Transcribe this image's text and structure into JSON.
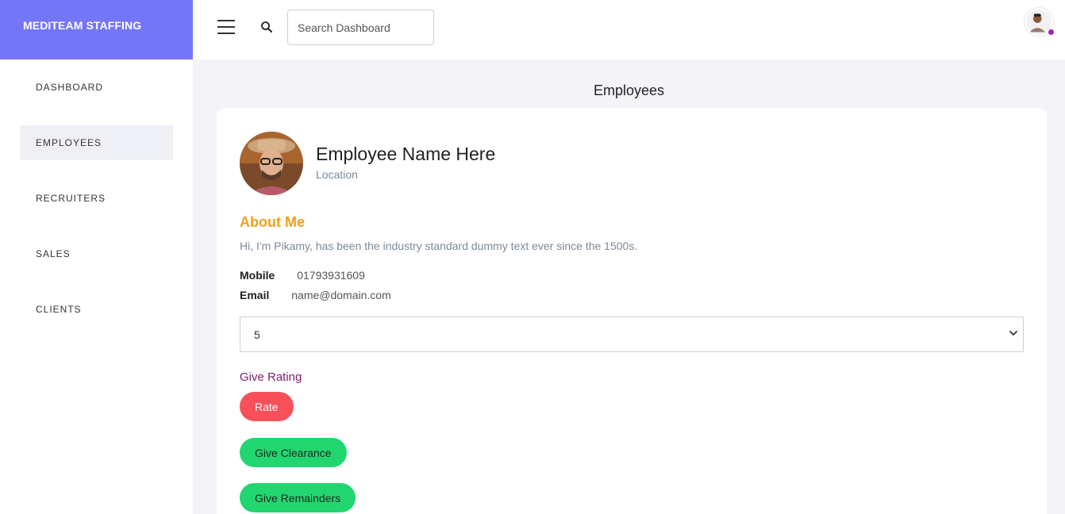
{
  "sidebar": {
    "brand": "MEDITEAM STAFFING",
    "items": [
      {
        "label": "DASHBOARD"
      },
      {
        "label": "EMPLOYEES"
      },
      {
        "label": "RECRUITERS"
      },
      {
        "label": "SALES"
      },
      {
        "label": "CLIENTS"
      }
    ],
    "active": "EMPLOYEES"
  },
  "topbar": {
    "search_placeholder": "Search Dashboard"
  },
  "page": {
    "title": "Employees"
  },
  "profile": {
    "name": "Employee Name Here",
    "location": "Location",
    "about_heading": "About Me",
    "about_text": "Hi, I'm Pikamy, has been the industry standard dummy text ever since the 1500s.",
    "mobile_label": "Mobile",
    "mobile_value": "01793931609",
    "email_label": "Email",
    "email_value": "name@domain.com",
    "rating_selected": "5",
    "rating_label": "Give Rating",
    "rate_button": "Rate",
    "clearance_button": "Give Clearance",
    "reminders_button": "Give Remainders"
  },
  "colors": {
    "brand": "#7575f8",
    "about_heading": "#f0a020",
    "rate_button": "#f7505a",
    "green_button": "#22d66f",
    "status_dot": "#a020c0"
  },
  "icons": [
    "menu-icon",
    "search-icon",
    "user-avatar-icon",
    "chevron-down-icon"
  ]
}
